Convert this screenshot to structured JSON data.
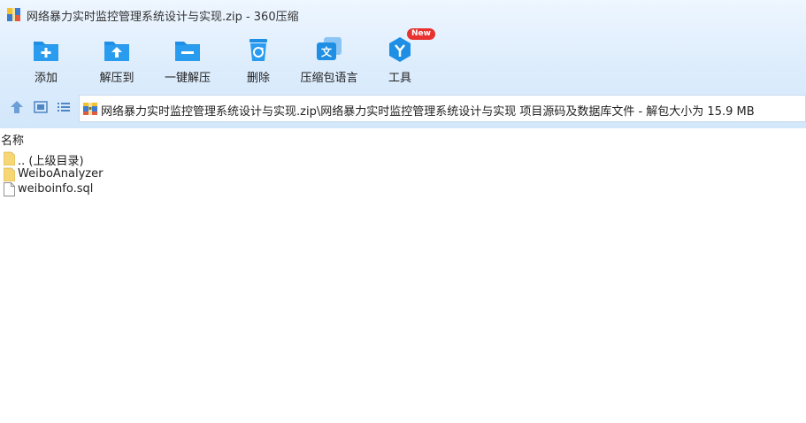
{
  "window": {
    "title": "网络暴力实时监控管理系统设计与实现.zip - 360压缩"
  },
  "toolbar": {
    "buttons": [
      {
        "id": "add",
        "label": "添加",
        "icon": "add-folder-icon"
      },
      {
        "id": "extract-to",
        "label": "解压到",
        "icon": "extract-folder-icon"
      },
      {
        "id": "one-click-extract",
        "label": "一键解压",
        "icon": "quick-extract-icon"
      },
      {
        "id": "delete",
        "label": "删除",
        "icon": "trash-icon"
      },
      {
        "id": "language",
        "label": "压缩包语言",
        "icon": "translate-icon"
      },
      {
        "id": "tools",
        "label": "工具",
        "icon": "tools-icon",
        "badge": "New"
      }
    ]
  },
  "pathbar": {
    "nav_icons": [
      "up-arrow-icon",
      "view-thumbnail-icon",
      "view-list-icon"
    ],
    "address": "网络暴力实时监控管理系统设计与实现.zip\\网络暴力实时监控管理系统设计与实现 项目源码及数据库文件 - 解包大小为 15.9 MB"
  },
  "file_list": {
    "column_header": "名称",
    "rows": [
      {
        "name": ".. (上级目录)",
        "type": "folder"
      },
      {
        "name": "WeiboAnalyzer",
        "type": "folder"
      },
      {
        "name": "weiboinfo.sql",
        "type": "file"
      }
    ]
  },
  "colors": {
    "accent": "#1e90e6",
    "badge": "#e8322f",
    "folder": "#f7d775"
  }
}
